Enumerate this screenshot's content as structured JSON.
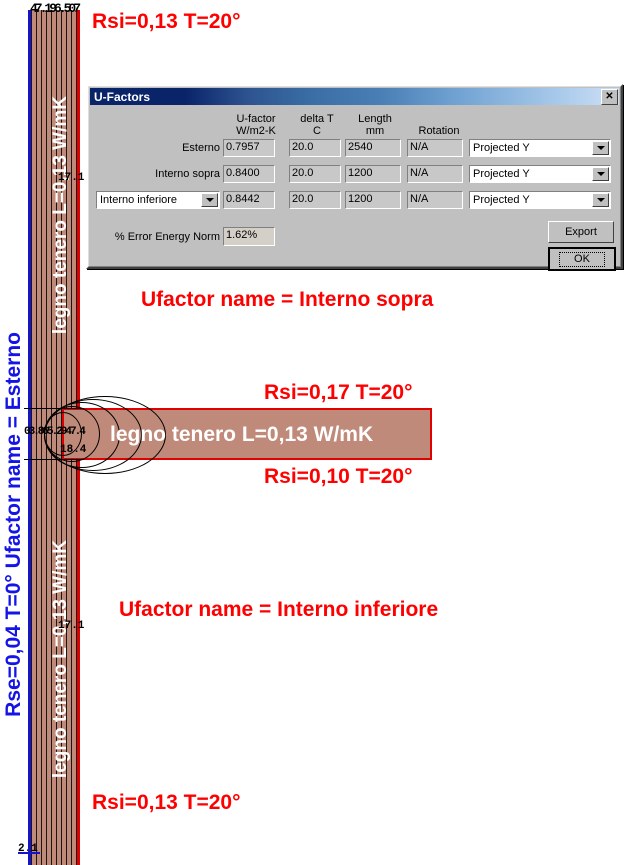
{
  "scene": {
    "wall_material_label": "legno tenero L=0,13 W/mK",
    "beam_material_label": "legno tenero L=0,13 W/mK",
    "exterior_boundary_label": "Rse=0,04 T=0° Ufactor name = Esterno",
    "isotherm_top_cluster": "47.196.507",
    "isotherm_mid_cluster": "03.865.2947.4",
    "isotherm_mid_lower": "18.4",
    "isotherm_upper_wall": "17.1",
    "isotherm_lower_wall": "17.1",
    "isotherm_origin": "2.1",
    "colors": {
      "wood": "#c08a7a",
      "exterior_edge": "#1414c8",
      "interior_edge": "#e00000",
      "annotation_red": "#ff0000",
      "annotation_blue": "#1414e6"
    }
  },
  "annotations": [
    {
      "id": "top-rsi",
      "text": "Rsi=0,13 T=20°"
    },
    {
      "id": "ufactor-sopra",
      "text": "Ufactor name = Interno sopra"
    },
    {
      "id": "beam-top-rsi",
      "text": "Rsi=0,17 T=20°"
    },
    {
      "id": "beam-bot-rsi",
      "text": "Rsi=0,10 T=20°"
    },
    {
      "id": "ufactor-inf",
      "text": "Ufactor name = Interno inferiore"
    },
    {
      "id": "bottom-rsi",
      "text": "Rsi=0,13 T=20°"
    }
  ],
  "dialog": {
    "title": "U-Factors",
    "close_label": "✕",
    "columns": [
      {
        "line1": "U-factor",
        "line2": "W/m2-K"
      },
      {
        "line1": "delta T",
        "line2": "C"
      },
      {
        "line1": "Length",
        "line2": "mm"
      },
      {
        "line1": "Rotation",
        "line2": ""
      }
    ],
    "rows": [
      {
        "name": "Esterno",
        "name_is_combo": false,
        "ufactor": "0.7957",
        "deltaT": "20.0",
        "length": "2540",
        "rotation": "N/A",
        "projection": "Projected Y"
      },
      {
        "name": "Interno sopra",
        "name_is_combo": false,
        "ufactor": "0.8400",
        "deltaT": "20.0",
        "length": "1200",
        "rotation": "N/A",
        "projection": "Projected Y"
      },
      {
        "name": "Interno inferiore",
        "name_is_combo": true,
        "ufactor": "0.8442",
        "deltaT": "20.0",
        "length": "1200",
        "rotation": "N/A",
        "projection": "Projected Y"
      }
    ],
    "error_label": "% Error Energy Norm",
    "error_value": "1.62%",
    "export_label": "Export",
    "ok_label": "OK"
  }
}
